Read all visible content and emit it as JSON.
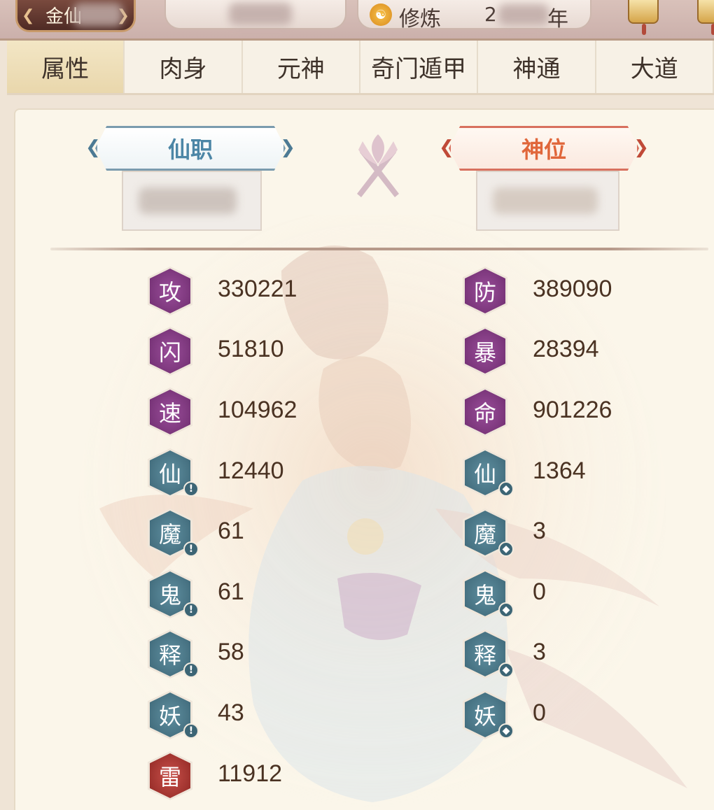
{
  "header": {
    "rank": "金仙",
    "cultivation_label": "修炼",
    "cultivation_value": "2",
    "cultivation_unit": "年"
  },
  "tabs": [
    {
      "label": "属性",
      "active": true
    },
    {
      "label": "肉身",
      "active": false
    },
    {
      "label": "元神",
      "active": false
    },
    {
      "label": "奇门遁甲",
      "active": false
    },
    {
      "label": "神通",
      "active": false
    },
    {
      "label": "大道",
      "active": false
    }
  ],
  "titles": {
    "left": "仙职",
    "right": "神位"
  },
  "stats_left": [
    {
      "icon": "攻",
      "value": "330221",
      "color": "purple",
      "badge": ""
    },
    {
      "icon": "闪",
      "value": "51810",
      "color": "purple",
      "badge": ""
    },
    {
      "icon": "速",
      "value": "104962",
      "color": "purple",
      "badge": ""
    },
    {
      "icon": "仙",
      "value": "12440",
      "color": "teal",
      "badge": "sword"
    },
    {
      "icon": "魔",
      "value": "61",
      "color": "teal",
      "badge": "sword"
    },
    {
      "icon": "鬼",
      "value": "61",
      "color": "teal",
      "badge": "sword"
    },
    {
      "icon": "释",
      "value": "58",
      "color": "teal",
      "badge": "sword"
    },
    {
      "icon": "妖",
      "value": "43",
      "color": "teal",
      "badge": "sword"
    },
    {
      "icon": "雷",
      "value": "11912",
      "color": "red",
      "badge": ""
    }
  ],
  "stats_right": [
    {
      "icon": "防",
      "value": "389090",
      "color": "purple",
      "badge": ""
    },
    {
      "icon": "暴",
      "value": "28394",
      "color": "purple",
      "badge": ""
    },
    {
      "icon": "命",
      "value": "901226",
      "color": "purple",
      "badge": ""
    },
    {
      "icon": "仙",
      "value": "1364",
      "color": "teal",
      "badge": "shield"
    },
    {
      "icon": "魔",
      "value": "3",
      "color": "teal",
      "badge": "shield"
    },
    {
      "icon": "鬼",
      "value": "0",
      "color": "teal",
      "badge": "shield"
    },
    {
      "icon": "释",
      "value": "3",
      "color": "teal",
      "badge": "shield"
    },
    {
      "icon": "妖",
      "value": "0",
      "color": "teal",
      "badge": "shield"
    }
  ],
  "colors": {
    "purple": "#7e3a80",
    "teal": "#497585",
    "red": "#a8322c",
    "accent_blue": "#4c86a6",
    "accent_orange": "#e0663a"
  }
}
